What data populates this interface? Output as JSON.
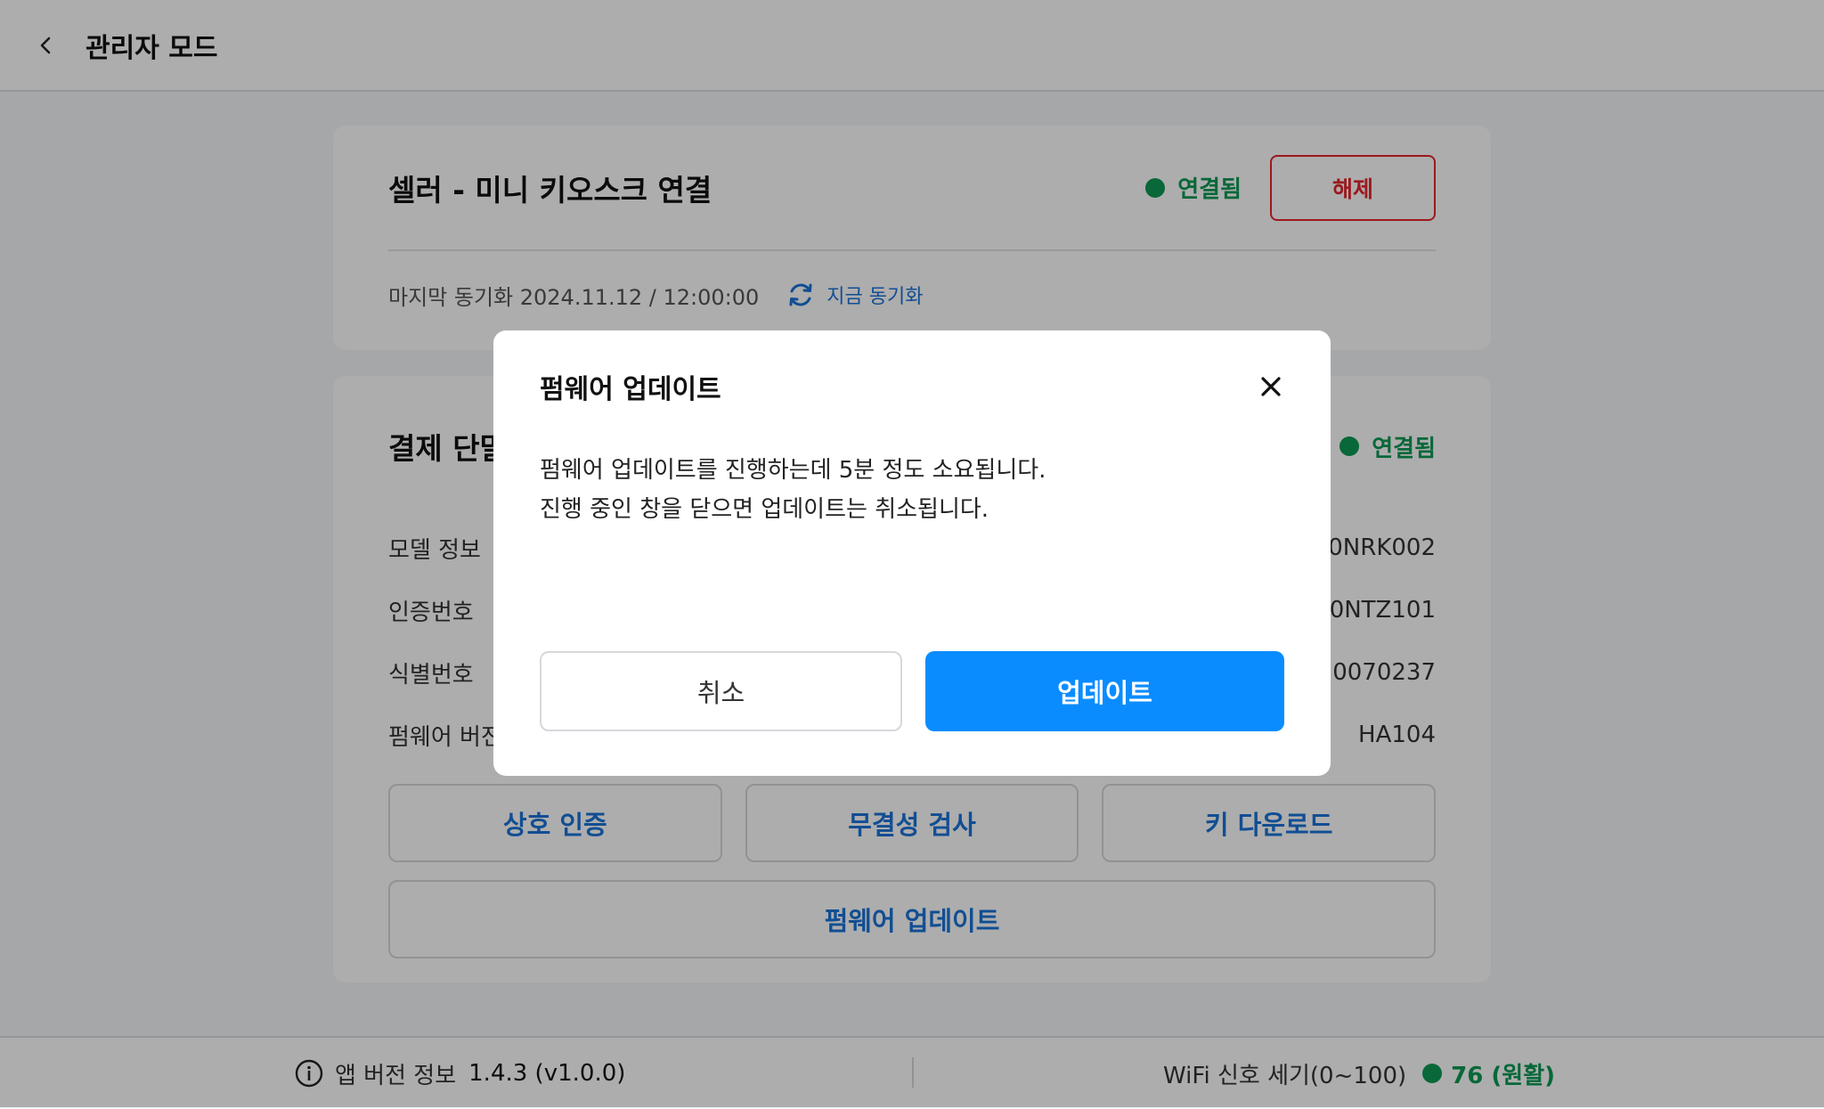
{
  "header": {
    "title": "관리자 모드",
    "back_icon": "chevron-left-icon"
  },
  "colors": {
    "connected": "#0d9a55",
    "danger": "#e5252b",
    "link": "#1a73d9",
    "primary": "#0a8cff"
  },
  "seller_card": {
    "title": "셀러 - 미니 키오스크 연결",
    "status": "연결됨",
    "disconnect_label": "해제",
    "last_sync": "마지막 동기화 2024.11.12 / 12:00:00",
    "sync_now_label": "지금 동기화"
  },
  "payment_card": {
    "title": "결제 단말",
    "status": "연결됨",
    "rows": [
      {
        "label": "모델 정보",
        "value": "0NRK002"
      },
      {
        "label": "인증번호",
        "value": "0NTZ101"
      },
      {
        "label": "식별번호",
        "value": "0070237"
      },
      {
        "label": "펌웨어 버전",
        "value": "HA104"
      }
    ],
    "buttons": [
      "상호 인증",
      "무결성 검사",
      "키 다운로드"
    ],
    "firmware_button": "펌웨어 업데이트"
  },
  "footer": {
    "app_version_label": "앱 버전 정보",
    "app_version": "1.4.3 (v1.0.0)",
    "wifi_label": "WiFi 신호 세기(0~100)",
    "wifi_value": "76 (원활)"
  },
  "modal": {
    "title": "펌웨어 업데이트",
    "body_line1": "펌웨어 업데이트를 진행하는데 5분 정도 소요됩니다.",
    "body_line2": "진행 중인 창을 닫으면 업데이트는 취소됩니다.",
    "cancel_label": "취소",
    "confirm_label": "업데이트"
  }
}
